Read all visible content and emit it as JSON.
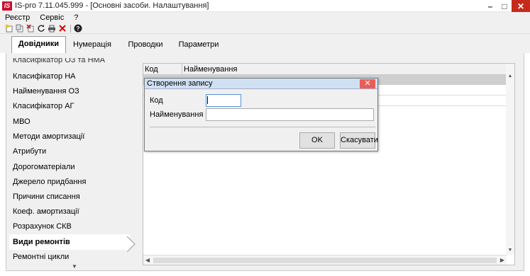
{
  "window": {
    "app_icon": "IS",
    "title": "IS-pro 7.11.045.999 - [Основні засоби. Налаштування]",
    "controls": [
      "minimize-icon",
      "maximize-icon",
      "close-icon"
    ]
  },
  "menu": {
    "items": [
      "Реєстр",
      "Сервіс",
      "?"
    ]
  },
  "toolbar": {
    "icons": [
      "add-icon",
      "add-copy-icon",
      "delete-record-icon",
      "refresh-icon",
      "print-icon",
      "delete-icon",
      "help-icon"
    ]
  },
  "tabs": [
    {
      "label": "Довідники",
      "active": true
    },
    {
      "label": "Нумерація",
      "active": false
    },
    {
      "label": "Проводки",
      "active": false
    },
    {
      "label": "Параметри",
      "active": false
    }
  ],
  "sidebar": {
    "cut_item": "Класифікатор ОЗ та НМА",
    "items": [
      {
        "label": "Класифікатор НА"
      },
      {
        "label": "Найменування ОЗ"
      },
      {
        "label": "Класифікатор АГ"
      },
      {
        "label": "МВО"
      },
      {
        "label": "Методи амортизації"
      },
      {
        "label": "Атрибути"
      },
      {
        "label": "Дорогоматеріали"
      },
      {
        "label": "Джерело придбання"
      },
      {
        "label": "Причини списання"
      },
      {
        "label": "Коеф. амортизації"
      },
      {
        "label": "Розрахунок СКВ"
      },
      {
        "label": "Види ремонтів",
        "active": true
      },
      {
        "label": "Ремонтні цикли"
      }
    ]
  },
  "grid": {
    "columns": [
      "Код",
      "Найменування"
    ]
  },
  "dialog": {
    "title": "Створення запису",
    "code_label": "Код",
    "code_value": "",
    "name_label": "Найменування",
    "name_value": "",
    "ok_label": "OK",
    "cancel_label": "Скасувати"
  }
}
